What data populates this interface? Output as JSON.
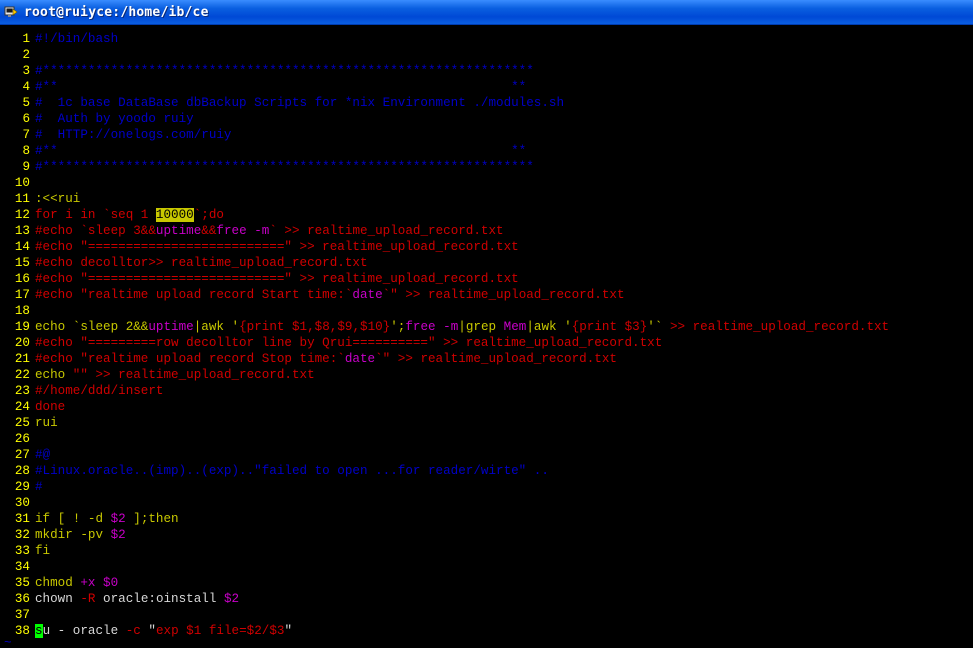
{
  "window": {
    "title": "root@ruiyce:/home/ib/ce"
  },
  "icons": {
    "title": "terminal-app-icon"
  },
  "colors": {
    "titlebar": "#0a5fe0",
    "background": "#000000",
    "line_numbers": "#ffff00",
    "comment": "#0000c8",
    "keyword": "#c8c800",
    "string": "#d00000",
    "identifier": "#d8d8d8",
    "special": "#c800c8",
    "search_highlight": "#c8c800",
    "cursor": "#00ff00"
  },
  "editor": {
    "lines": [
      {
        "n": "1",
        "tokens": [
          {
            "t": "#!/bin/bash",
            "c": "comment"
          }
        ]
      },
      {
        "n": "2",
        "tokens": []
      },
      {
        "n": "3",
        "tokens": [
          {
            "t": "#*****************************************************************",
            "c": "comment"
          }
        ]
      },
      {
        "n": "4",
        "tokens": [
          {
            "t": "#**                                                            **",
            "c": "comment"
          }
        ]
      },
      {
        "n": "5",
        "tokens": [
          {
            "t": "#  1c base DataBase dbBackup Scripts for *nix Environment ./modules.sh",
            "c": "comment"
          }
        ]
      },
      {
        "n": "6",
        "tokens": [
          {
            "t": "#  Auth by yoodo ruiy",
            "c": "comment"
          }
        ]
      },
      {
        "n": "7",
        "tokens": [
          {
            "t": "#  HTTP://onelogs.com/ruiy",
            "c": "comment"
          }
        ]
      },
      {
        "n": "8",
        "tokens": [
          {
            "t": "#**                                                            **",
            "c": "comment"
          }
        ]
      },
      {
        "n": "9",
        "tokens": [
          {
            "t": "#*****************************************************************",
            "c": "comment"
          }
        ]
      },
      {
        "n": "10",
        "tokens": []
      },
      {
        "n": "11",
        "tokens": [
          {
            "t": ":<<rui",
            "c": "kw"
          }
        ]
      },
      {
        "n": "12",
        "tokens": [
          {
            "t": "for i in `seq 1 ",
            "c": "str"
          },
          {
            "t": "10000",
            "c": "hl"
          },
          {
            "t": "`;do",
            "c": "str"
          }
        ]
      },
      {
        "n": "13",
        "tokens": [
          {
            "t": "#echo `sleep 3&&",
            "c": "str"
          },
          {
            "t": "uptime",
            "c": "purple"
          },
          {
            "t": "&&",
            "c": "str"
          },
          {
            "t": "free -m",
            "c": "purple"
          },
          {
            "t": "` >> realtime_upload_record.txt",
            "c": "str"
          }
        ]
      },
      {
        "n": "14",
        "tokens": [
          {
            "t": "#echo \"==========================\" >> realtime_upload_record.txt",
            "c": "str"
          }
        ]
      },
      {
        "n": "15",
        "tokens": [
          {
            "t": "#echo decolltor>> realtime_upload_record.txt",
            "c": "str"
          }
        ]
      },
      {
        "n": "16",
        "tokens": [
          {
            "t": "#echo \"==========================\" >> realtime_upload_record.txt",
            "c": "str"
          }
        ]
      },
      {
        "n": "17",
        "tokens": [
          {
            "t": "#echo \"realtime upload record Start time:`",
            "c": "str"
          },
          {
            "t": "date",
            "c": "purple"
          },
          {
            "t": "`\" >> realtime_upload_record.txt",
            "c": "str"
          }
        ]
      },
      {
        "n": "18",
        "tokens": []
      },
      {
        "n": "19",
        "tokens": [
          {
            "t": "echo `sleep 2&&",
            "c": "kw"
          },
          {
            "t": "uptime",
            "c": "purple"
          },
          {
            "t": "|awk '",
            "c": "kw"
          },
          {
            "t": "{print $1,$8,$9,$10}",
            "c": "str"
          },
          {
            "t": "';",
            "c": "kw"
          },
          {
            "t": "free -m",
            "c": "purple"
          },
          {
            "t": "|grep ",
            "c": "kw"
          },
          {
            "t": "Mem",
            "c": "purple"
          },
          {
            "t": "|awk '",
            "c": "kw"
          },
          {
            "t": "{print $3}",
            "c": "str"
          },
          {
            "t": "'`",
            "c": "kw"
          },
          {
            "t": " >> realtime_upload_record.txt",
            "c": "str"
          }
        ]
      },
      {
        "n": "20",
        "tokens": [
          {
            "t": "#echo \"=========row decolltor line by Qrui==========\" >> realtime_upload_record.txt",
            "c": "str"
          }
        ]
      },
      {
        "n": "21",
        "tokens": [
          {
            "t": "#echo \"realtime upload record Stop time:`",
            "c": "str"
          },
          {
            "t": "date",
            "c": "purple"
          },
          {
            "t": "`\" >> realtime_upload_record.txt",
            "c": "str"
          }
        ]
      },
      {
        "n": "22",
        "tokens": [
          {
            "t": "echo ",
            "c": "kw"
          },
          {
            "t": "\"\" >> realtime_upload_record.txt",
            "c": "str"
          }
        ]
      },
      {
        "n": "23",
        "tokens": [
          {
            "t": "#/home/ddd/insert",
            "c": "str"
          }
        ]
      },
      {
        "n": "24",
        "tokens": [
          {
            "t": "done",
            "c": "str"
          }
        ]
      },
      {
        "n": "25",
        "tokens": [
          {
            "t": "rui",
            "c": "kw"
          }
        ]
      },
      {
        "n": "26",
        "tokens": []
      },
      {
        "n": "27",
        "tokens": [
          {
            "t": "#@",
            "c": "comment"
          }
        ]
      },
      {
        "n": "28",
        "tokens": [
          {
            "t": "#Linux.oracle..(imp)..(exp)..\"failed to open ...for reader/wirte\" ..",
            "c": "comment"
          }
        ]
      },
      {
        "n": "29",
        "tokens": [
          {
            "t": "#",
            "c": "comment"
          }
        ]
      },
      {
        "n": "30",
        "tokens": []
      },
      {
        "n": "31",
        "tokens": [
          {
            "t": "if [ ! -d ",
            "c": "kw"
          },
          {
            "t": "$2",
            "c": "purple"
          },
          {
            "t": " ];then",
            "c": "kw"
          }
        ]
      },
      {
        "n": "32",
        "tokens": [
          {
            "t": "mkdir -pv ",
            "c": "kw"
          },
          {
            "t": "$2",
            "c": "purple"
          }
        ]
      },
      {
        "n": "33",
        "tokens": [
          {
            "t": "fi",
            "c": "kw"
          }
        ]
      },
      {
        "n": "34",
        "tokens": []
      },
      {
        "n": "35",
        "tokens": [
          {
            "t": "chmod ",
            "c": "kw"
          },
          {
            "t": "+x $0",
            "c": "purple"
          }
        ]
      },
      {
        "n": "36",
        "tokens": [
          {
            "t": "chown ",
            "c": "ident"
          },
          {
            "t": "-R",
            "c": "str"
          },
          {
            "t": " oracle:oinstall ",
            "c": "ident"
          },
          {
            "t": "$2",
            "c": "purple"
          }
        ]
      },
      {
        "n": "37",
        "tokens": []
      },
      {
        "n": "38",
        "tokens": [
          {
            "t": "s",
            "c": "cursor"
          },
          {
            "t": "u - oracle ",
            "c": "ident"
          },
          {
            "t": "-c",
            "c": "str"
          },
          {
            "t": " \"",
            "c": "ident"
          },
          {
            "t": "exp $1 file=$2/$3",
            "c": "str"
          },
          {
            "t": "\"",
            "c": "ident"
          }
        ]
      }
    ],
    "tilde": "~"
  }
}
